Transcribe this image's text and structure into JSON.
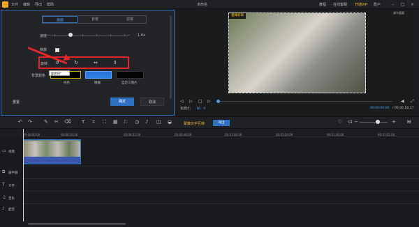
{
  "titlebar": {
    "menu": [
      "文件",
      "编辑",
      "导出",
      "帮助"
    ],
    "title": "未命名",
    "right_items": [
      "教程",
      "在线客服",
      "开通VIP",
      "账户"
    ],
    "window_controls": [
      "minimize-icon",
      "maximize-icon",
      "close-icon"
    ]
  },
  "editor": {
    "tabs": [
      "画面",
      "背景",
      "滤镜"
    ],
    "speed_label": "速度",
    "speed_value": "1.0x",
    "reverse_label": "倒放",
    "rotate_label": "旋转",
    "bg_label": "背景颜色",
    "tooltip": "旋转90°",
    "swatches": [
      "纯色",
      "模糊",
      "自定义图片"
    ],
    "reset": "重置",
    "ok": "确定",
    "cancel": "取消"
  },
  "preview": {
    "badge": "蜜蜂剪辑",
    "ratio_label": "宽高比：",
    "ratio_value": "16：9",
    "time_current": "00:00:00.00",
    "time_total": "/ 00:00:18.17",
    "fullscreen": "调节画面"
  },
  "toolbar": {
    "text_promo": "蒙蔽文字互转",
    "export_label": "导出"
  },
  "ruler": {
    "ticks": [
      "00:00:00.00",
      "00:00:16.00",
      "00:00:32.00",
      "00:00:48.00",
      "00:01:04.00",
      "00:01:20.00",
      "00:01:36.00",
      "00:01:52.00"
    ]
  },
  "tracks": [
    "视频",
    "画中画",
    "文字",
    "音乐",
    "配音"
  ]
}
